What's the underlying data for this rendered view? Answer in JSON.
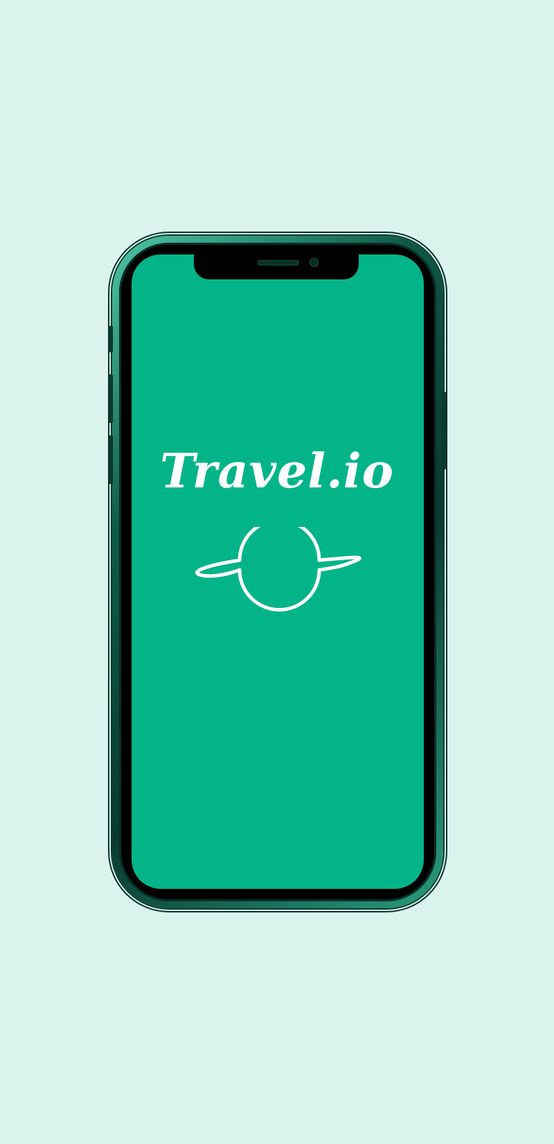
{
  "brand": {
    "name": "Travel.io",
    "logo_icon": "planet-icon"
  },
  "colors": {
    "background": "#daf3ec",
    "screen": "#04b489",
    "logo": "#ffffff"
  }
}
